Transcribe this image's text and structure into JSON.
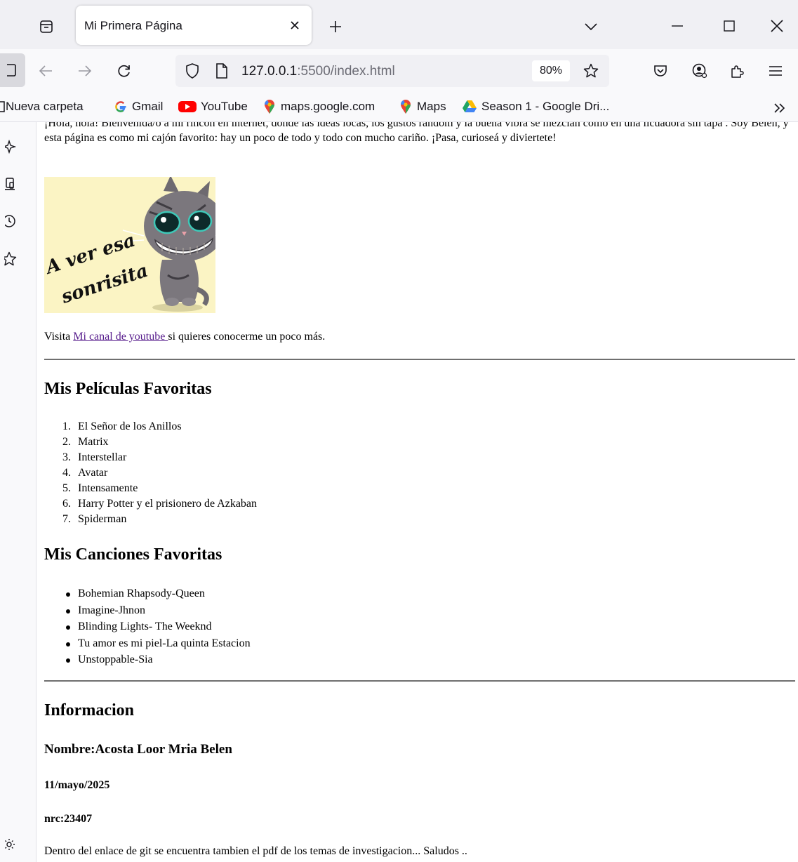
{
  "browser": {
    "tab_title": "Mi Primera Página",
    "url_host": "127.0.0.1",
    "url_rest": ":5500/index.html",
    "zoom": "80%"
  },
  "bookmarks": [
    {
      "label": "Nueva carpeta",
      "icon": "folder-icon"
    },
    {
      "label": "Gmail",
      "icon": "google-icon"
    },
    {
      "label": "YouTube",
      "icon": "youtube-icon"
    },
    {
      "label": "maps.google.com",
      "icon": "maps-pin-icon"
    },
    {
      "label": "Maps",
      "icon": "maps-pin-icon"
    },
    {
      "label": "Season 1 - Google Dri...",
      "icon": "google-drive-icon"
    }
  ],
  "page": {
    "intro": "¡Hola, hola! Bienvenida/o a mi rincón en internet, donde las ideas locas, los gustos random y la buena vibra se mezclan como en una licuadora sin tapa . Soy Belén, y esta página es como mi cajón favorito: hay un poco de todo y todo con mucho cariño. ¡Pasa, curioseá y diviertete!",
    "image_caption": "A ver esa sonrisita",
    "visit_prefix": "Visita ",
    "visit_link": "Mi canal de youtube ",
    "visit_suffix": " si quieres conocerme un poco más.",
    "movies_heading": "Mis Películas Favoritas",
    "movies": [
      "El Señor de los Anillos",
      "Matrix",
      "Interstellar",
      "Avatar",
      "Intensamente",
      "Harry Potter y el prisionero de Azkaban",
      "Spiderman"
    ],
    "songs_heading": "Mis Canciones Favoritas",
    "songs": [
      "Bohemian Rhapsody-Queen",
      "Imagine-Jhnon",
      "Blinding Lights- The Weeknd",
      "Tu amor es mi piel-La quinta Estacion",
      "Unstoppable-Sia"
    ],
    "info_heading": "Informacion",
    "name": "Nombre:Acosta Loor Mria Belen",
    "date": "11/mayo/2025",
    "nrc": "nrc:23407",
    "closing": "Dentro del enlace de git se encuentra tambien el pdf de los temas de investigacion... Saludos .."
  }
}
